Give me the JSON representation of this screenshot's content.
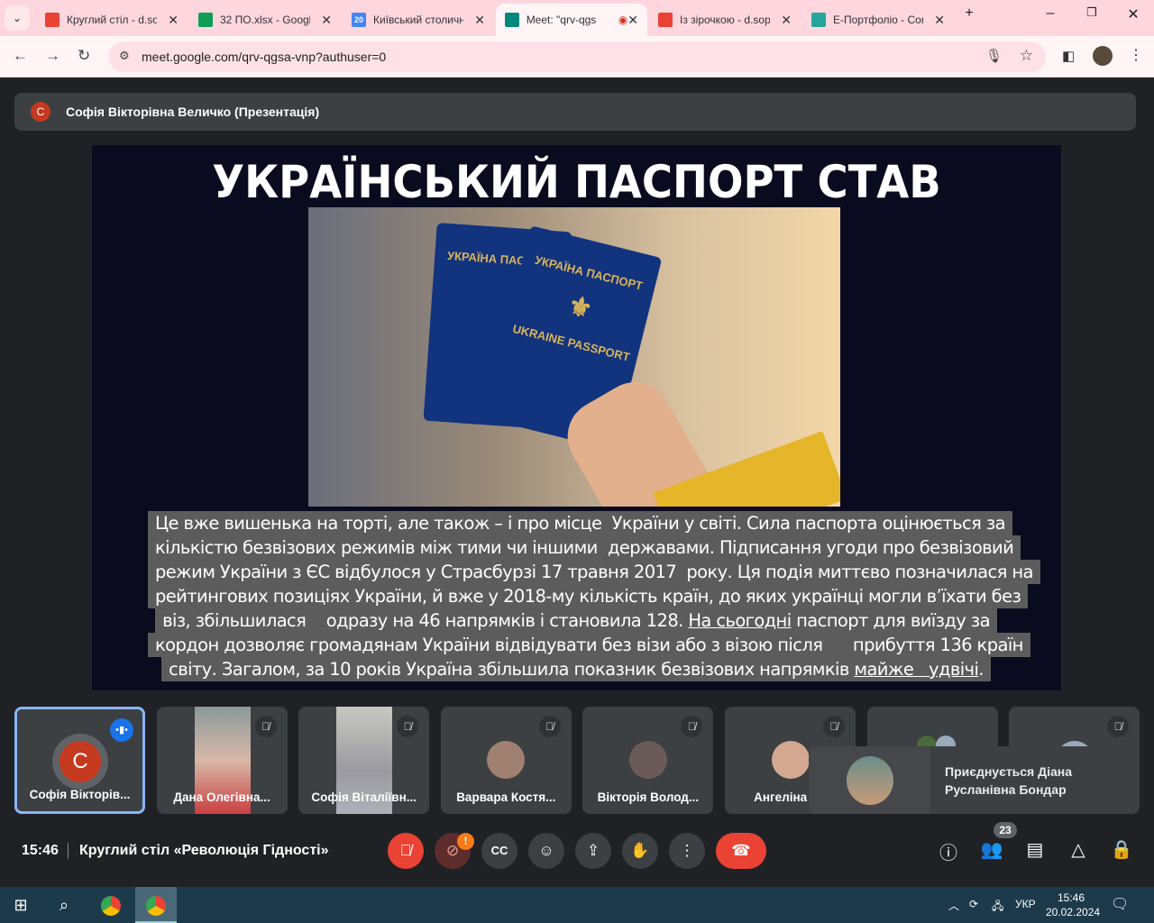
{
  "browser": {
    "tabs": [
      {
        "title": "Круглий стіл - d.so",
        "icon": "gmail-icon",
        "color": "#ea4335"
      },
      {
        "title": "32 ПО.xlsx - Googl",
        "icon": "sheets-icon",
        "color": "#0f9d58"
      },
      {
        "title": "Київський столичн",
        "icon": "calendar-icon",
        "color": "#4285f4",
        "glyph": "20"
      },
      {
        "title": "Meet: \"qrv-qgs",
        "icon": "meet-icon",
        "color": "#00897b",
        "active": true
      },
      {
        "title": "Із зірочкою - d.sop",
        "icon": "gmail-icon",
        "color": "#ea4335"
      },
      {
        "title": "Е-Портфоліо - Cor",
        "icon": "portfolio-icon",
        "color": "#26a69a"
      }
    ],
    "url": "meet.google.com/qrv-qgsa-vnp?authuser=0"
  },
  "presenter": {
    "initial": "С",
    "title": "Софія Вікторівна Величко (Презентація)"
  },
  "slide": {
    "title": "УКРАЇНСЬКИЙ ПАСПОРТ СТАВ СИЛЬНИМ",
    "passport_back": "УКРАЇНА ПАСПОРТ",
    "passport_front": "УКРАЇНА ПАСПОРТ",
    "passport_front_bottom": "UKRAINE PASSPORT",
    "caption": [
      [
        {
          "t": "Це вже вишенька на торті, але також – і про місце  України у світі. Сила паспорта оцінюється за"
        }
      ],
      [
        {
          "t": "кількістю безвізових режимів між тими чи іншими  державами. Підписання угоди про безвізовий"
        }
      ],
      [
        {
          "t": "режим України з ЄС відбулося у Страсбурзі 17 травня 2017  року. Ця подія миттєво позначилася на"
        }
      ],
      [
        {
          "t": "рейтингових позиціях України, й вже у 2018-му кількість країн, до яких українці могли в’їхати без"
        }
      ],
      [
        {
          "t": "віз, збільшилася    одразу на 46 напрямків і становила 128. "
        },
        {
          "t": "На сьогодні",
          "u": true
        },
        {
          "t": " паспорт для виїзду за"
        }
      ],
      [
        {
          "t": "кордон дозволяє громадянам України відвідувати без візи або з візою після      прибуття 136 країн"
        }
      ],
      [
        {
          "t": "світу. Загалом, за 10 років Україна збільшила показник безвізових напрямків "
        },
        {
          "t": "майже   удвічі",
          "u": true
        },
        {
          "t": "."
        }
      ]
    ]
  },
  "participants": [
    {
      "name": "Софія Вікторів...",
      "initial": "С",
      "speaking": true
    },
    {
      "name": "Дана Олегівна...",
      "video": true
    },
    {
      "name": "Софія Віталіївн...",
      "video": true
    },
    {
      "name": "Варвара Костя..."
    },
    {
      "name": "Вікторія Волод..."
    },
    {
      "name": "Ангеліна Во"
    },
    {
      "name": ""
    },
    {
      "name": ""
    }
  ],
  "notification": {
    "line1": "Приєднується Діана",
    "line2": "Русланівна Бондар"
  },
  "meeting": {
    "time": "15:46",
    "title": "Круглий стіл «Революція Гідності»",
    "participants_count": "23",
    "camera_warning": "!"
  },
  "taskbar": {
    "lang": "УКР",
    "time": "15:46",
    "date": "20.02.2024"
  }
}
